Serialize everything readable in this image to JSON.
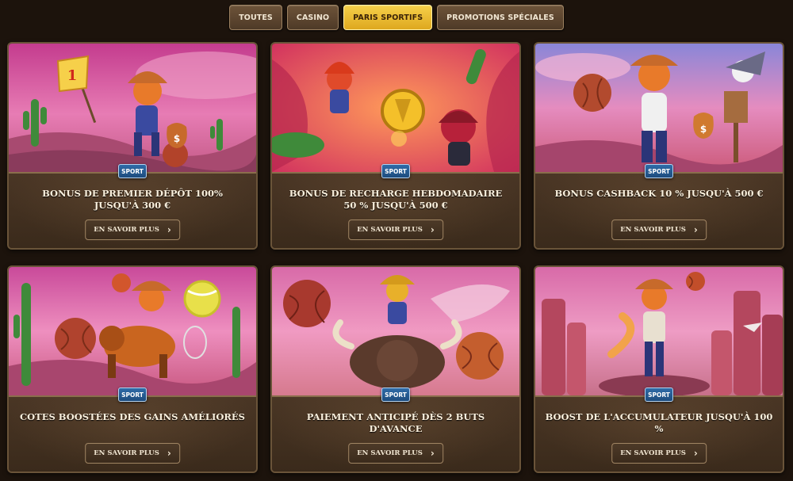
{
  "tabs": [
    {
      "label": "TOUTES",
      "active": false
    },
    {
      "label": "CASINO",
      "active": false
    },
    {
      "label": "PARIS SPORTIFS",
      "active": true
    },
    {
      "label": "PROMOTIONS SPÉCIALES",
      "active": false
    }
  ],
  "badge_label": "SPORT",
  "button_label": "EN SAVOIR PLUS",
  "button_icon": "chevron-right-icon",
  "colors": {
    "active_tab": "#f0c232",
    "tab": "#5b4430",
    "page_background": "#1c130c",
    "badge": "#2a5f96"
  },
  "promotions": [
    {
      "title": "BONUS DE PREMIER DÉPÔT 100% JUSQU'À 300 €",
      "illustration": "cowboy-lizard-with-flag-and-money-bag"
    },
    {
      "title": "BONUS DE RECHARGE HEBDOMADAIRE 50 % JUSQU'À 500 €",
      "illustration": "cowboy-lizard-with-gold-coin-and-cactus"
    },
    {
      "title": "BONUS CASHBACK 10 % JUSQU'À 500 €",
      "illustration": "cowboy-lizard-with-ball-and-vulture"
    },
    {
      "title": "COTES BOOSTÉES DES GAINS AMÉLIORÉS",
      "illustration": "cowboy-lizard-riding-horse-with-balls"
    },
    {
      "title": "PAIEMENT ANTICIPÉ DÈS 2 BUTS D'AVANCE",
      "illustration": "cowboy-lizard-riding-bull-with-balls"
    },
    {
      "title": "BOOST DE L'ACCUMULATEUR JUSQU'À 100 %",
      "illustration": "cowboy-lizard-in-canyon-with-ball"
    }
  ]
}
